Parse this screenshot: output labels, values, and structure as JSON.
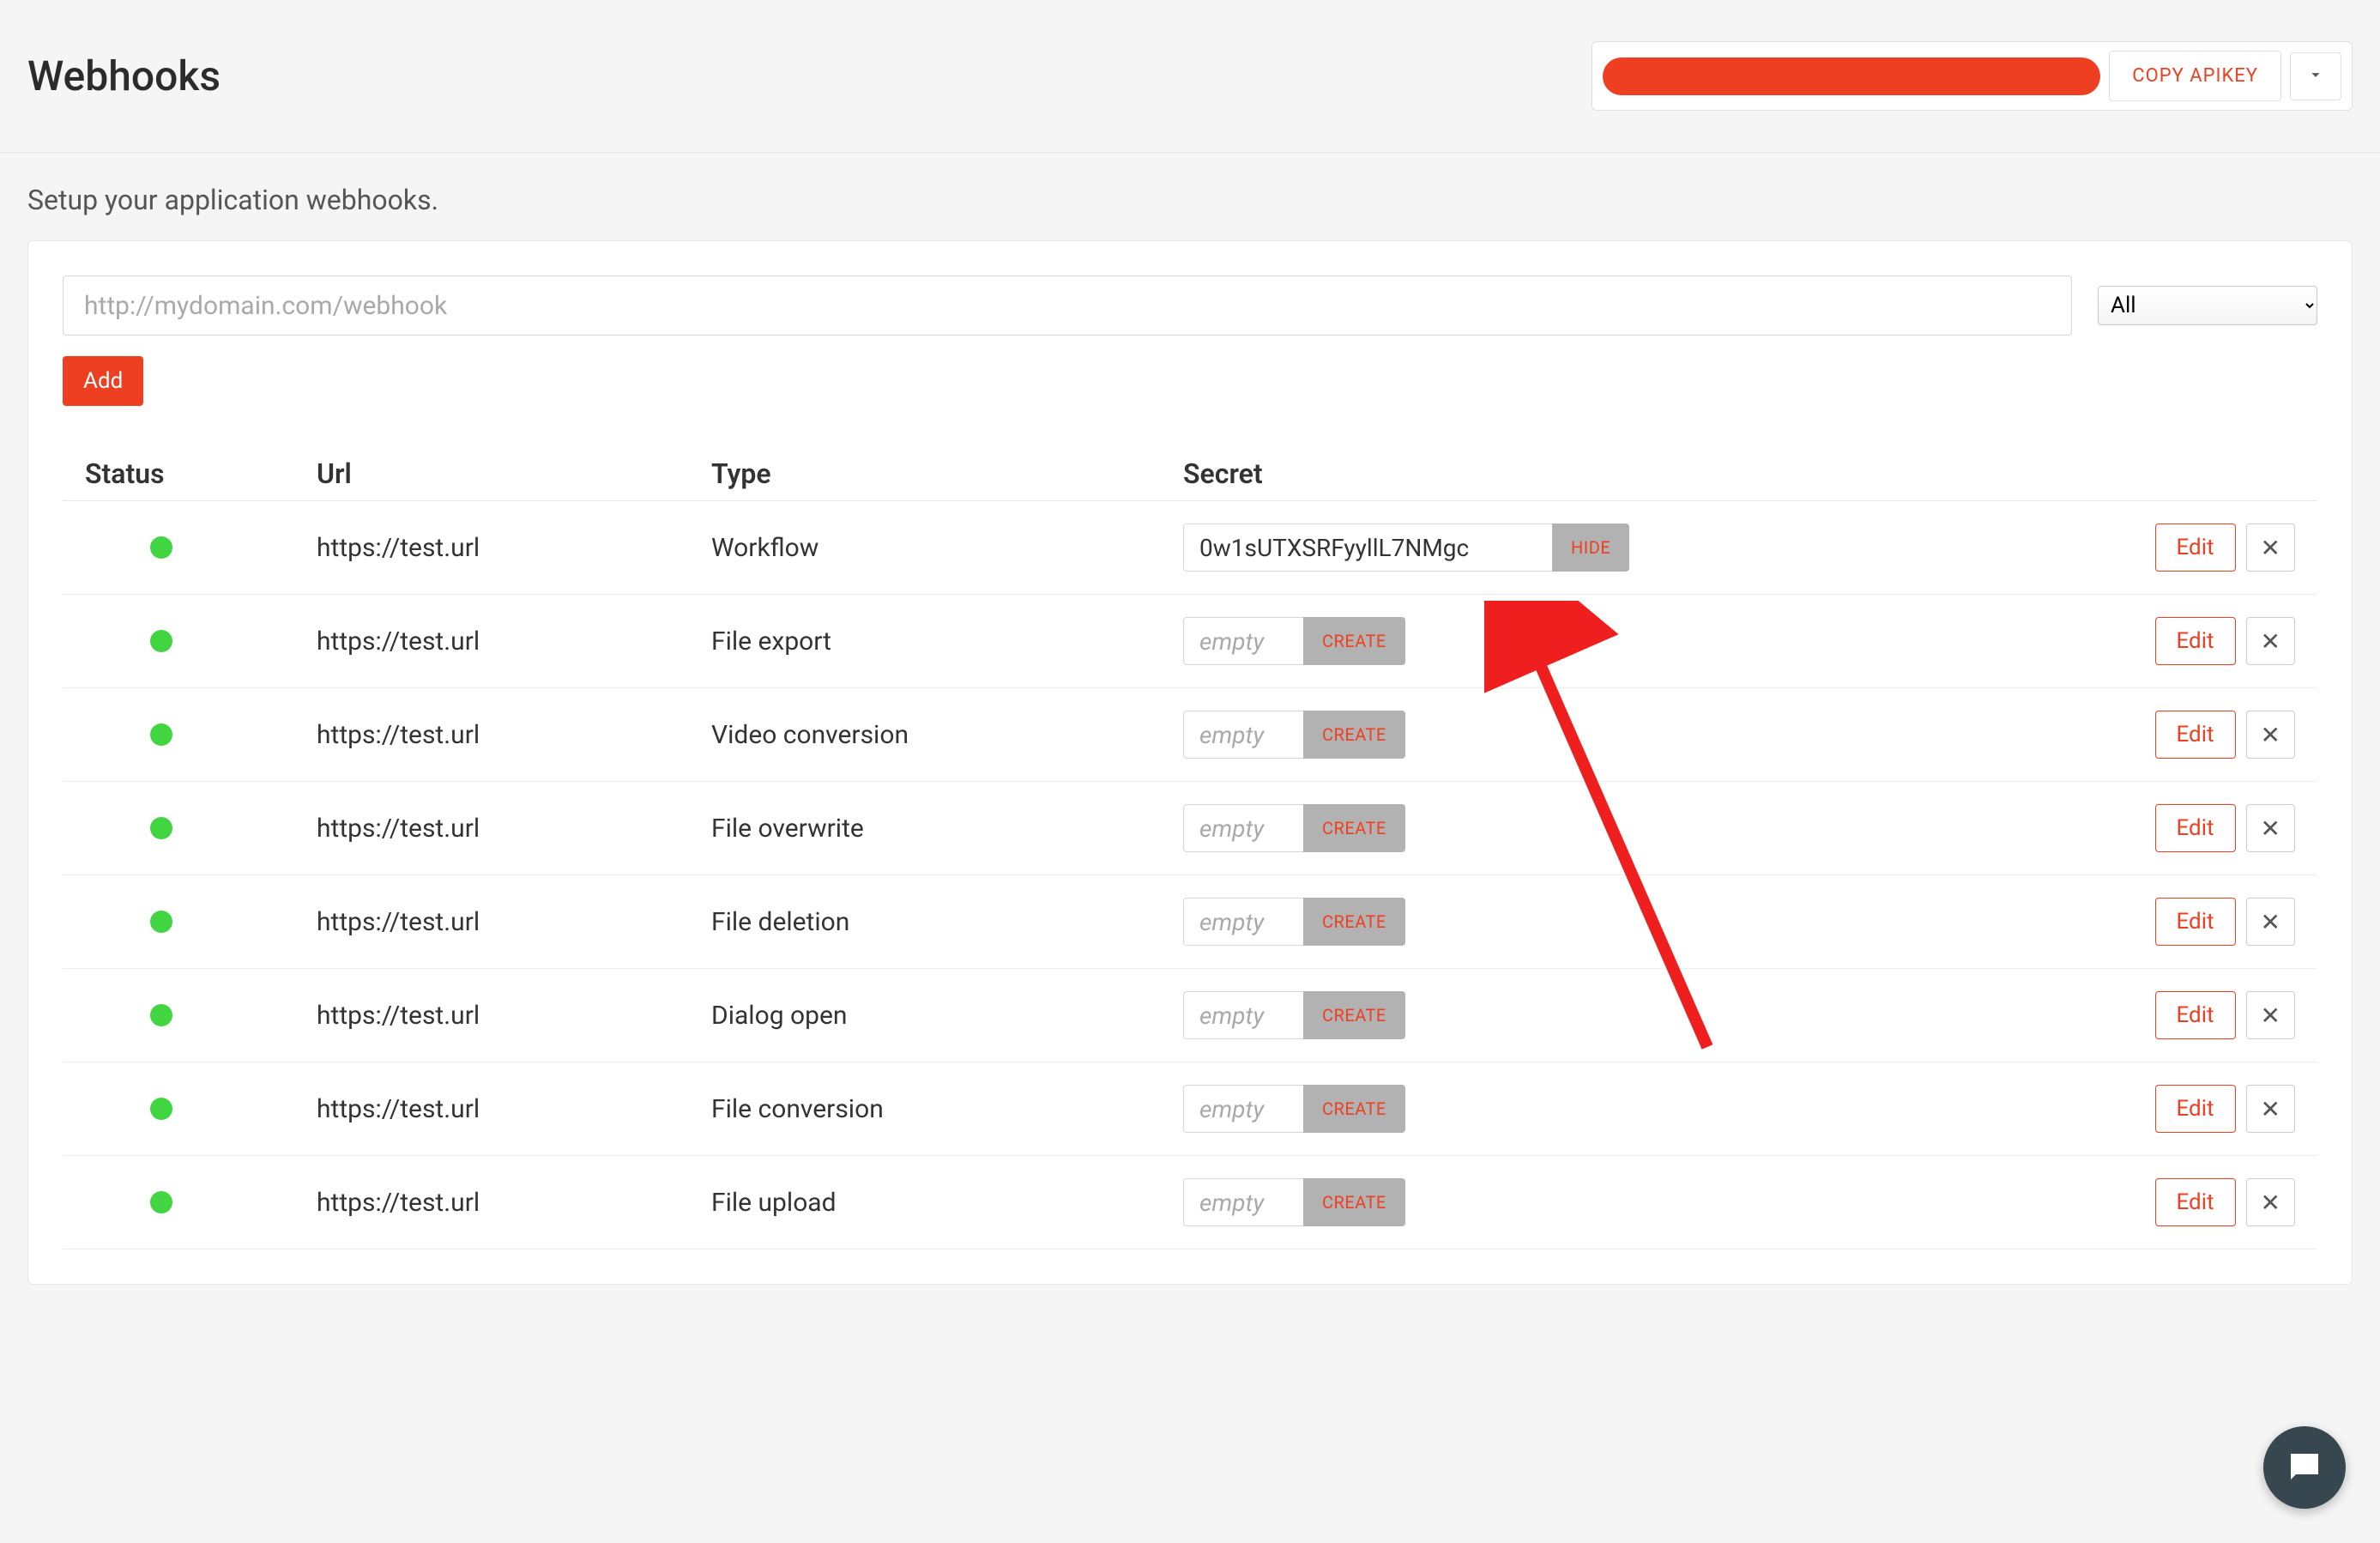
{
  "header": {
    "title": "Webhooks",
    "copy_label": "COPY APIKEY"
  },
  "subtitle": "Setup your application webhooks.",
  "form": {
    "url_placeholder": "http://mydomain.com/webhook",
    "type_selected": "All",
    "add_label": "Add"
  },
  "table": {
    "headers": {
      "status": "Status",
      "url": "Url",
      "type": "Type",
      "secret": "Secret"
    },
    "secret_empty_placeholder": "empty",
    "create_label": "CREATE",
    "hide_label": "HIDE",
    "edit_label": "Edit",
    "rows": [
      {
        "url": "https://test.url",
        "type": "Workflow",
        "secret": "0w1sUTXSRFyyllL7NMgc",
        "revealed": true
      },
      {
        "url": "https://test.url",
        "type": "File export",
        "secret": "",
        "revealed": false
      },
      {
        "url": "https://test.url",
        "type": "Video conversion",
        "secret": "",
        "revealed": false
      },
      {
        "url": "https://test.url",
        "type": "File overwrite",
        "secret": "",
        "revealed": false
      },
      {
        "url": "https://test.url",
        "type": "File deletion",
        "secret": "",
        "revealed": false
      },
      {
        "url": "https://test.url",
        "type": "Dialog open",
        "secret": "",
        "revealed": false
      },
      {
        "url": "https://test.url",
        "type": "File conversion",
        "secret": "",
        "revealed": false
      },
      {
        "url": "https://test.url",
        "type": "File upload",
        "secret": "",
        "revealed": false
      }
    ]
  },
  "colors": {
    "accent": "#EF3F23",
    "status_ok": "#41d641"
  }
}
